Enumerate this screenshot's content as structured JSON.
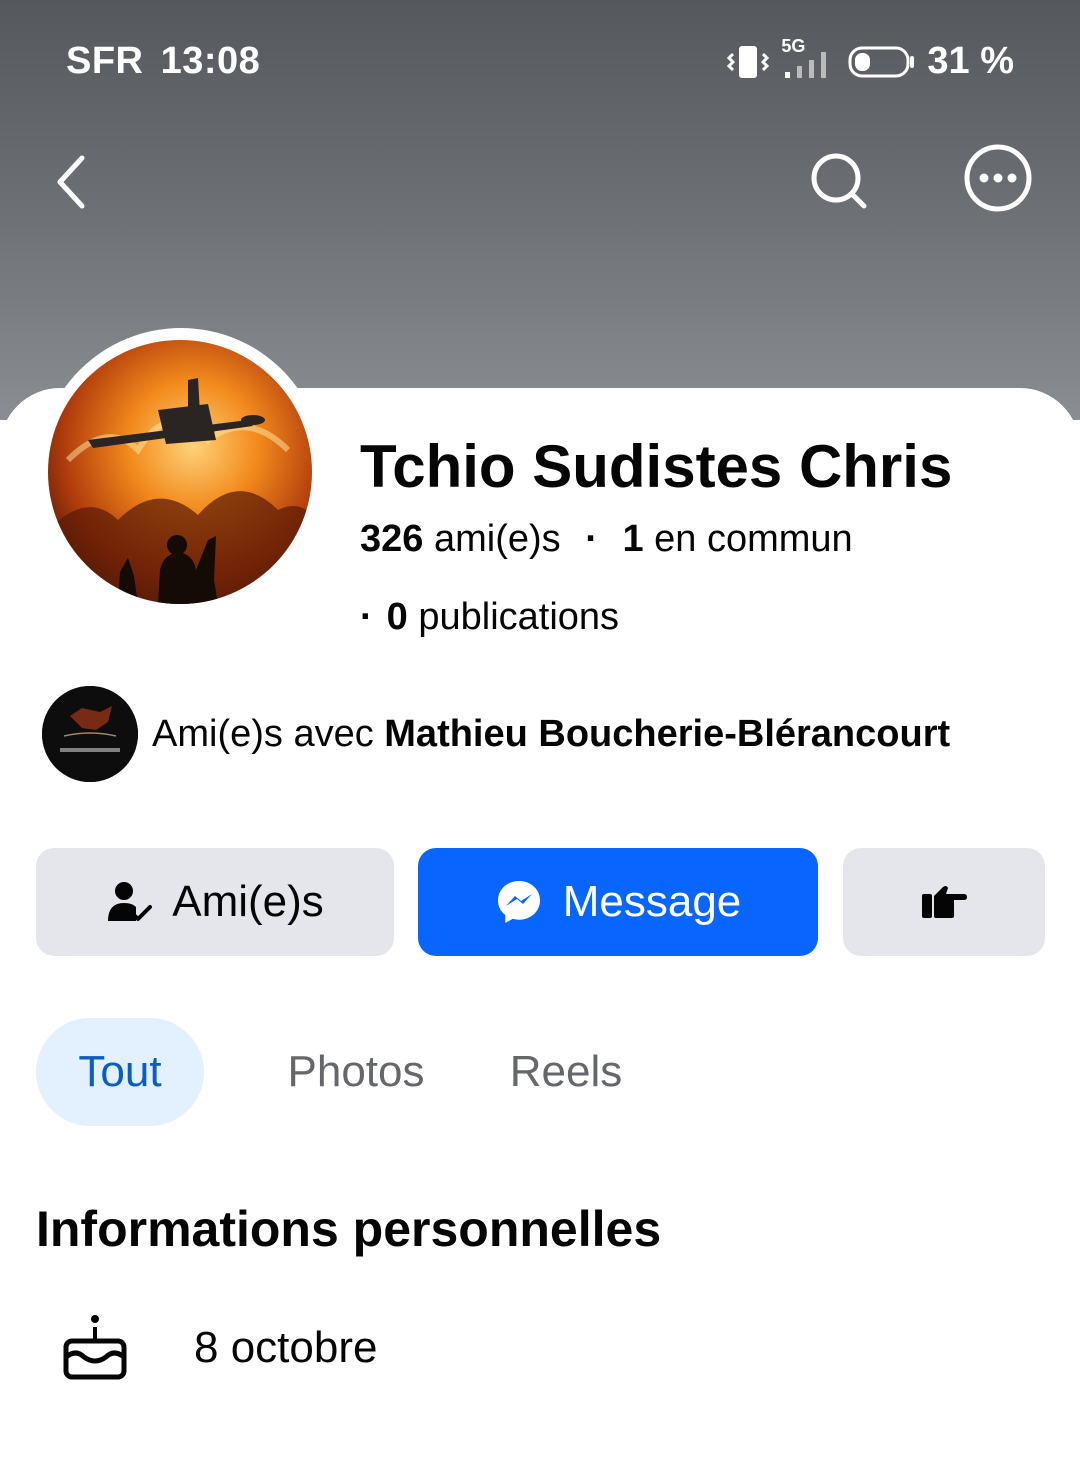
{
  "status_bar": {
    "carrier": "SFR",
    "time": "13:08",
    "network": "5G",
    "battery": "31 %",
    "battery_level": 0.31
  },
  "nav": {
    "back_icon": "chevron-left-icon",
    "search_icon": "search-icon",
    "more_icon": "more-icon"
  },
  "profile": {
    "name": "Tchio Sudistes Chris",
    "friends_count": "326",
    "friends_label": "ami(e)s",
    "mutual_count": "1",
    "mutual_label": "en commun",
    "posts_count": "0",
    "posts_label": "publications"
  },
  "mutual_friend": {
    "prefix": "Ami(e)s avec",
    "name": "Mathieu Boucherie-Blérancourt"
  },
  "actions": {
    "friends_label": "Ami(e)s",
    "message_label": "Message",
    "poke_icon": "poke-icon"
  },
  "tabs": [
    {
      "label": "Tout",
      "active": true
    },
    {
      "label": "Photos",
      "active": false
    },
    {
      "label": "Reels",
      "active": false
    }
  ],
  "info": {
    "title": "Informations personnelles",
    "birthday": "8 octobre"
  },
  "colors": {
    "accent": "#0866ff",
    "tab_active_bg": "#e3f0fd",
    "tab_active_text": "#0a5dc2",
    "button_grey": "#e4e6eb"
  }
}
